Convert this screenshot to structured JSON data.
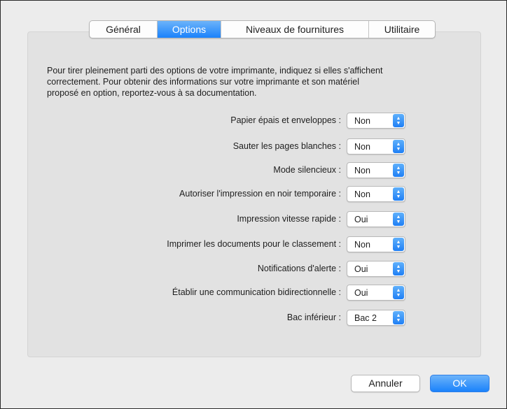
{
  "tabs": [
    {
      "label": "Général"
    },
    {
      "label": "Options"
    },
    {
      "label": "Niveaux de fournitures"
    },
    {
      "label": "Utilitaire"
    }
  ],
  "active_tab": "Options",
  "intro": {
    "line1": "Pour tirer pleinement parti des options de votre imprimante, indiquez si elles s'affichent",
    "line2": "correctement. Pour obtenir des informations sur votre imprimante et son matériel",
    "line3": "proposé en option, reportez-vous à sa documentation."
  },
  "options": [
    {
      "label": "Papier épais et enveloppes :",
      "value": "Non"
    },
    {
      "label": "Sauter les pages blanches :",
      "value": "Non"
    },
    {
      "label": "Mode silencieux :",
      "value": "Non"
    },
    {
      "label": "Autoriser l'impression en noir temporaire :",
      "value": "Non"
    },
    {
      "label": "Impression vitesse rapide :",
      "value": "Oui"
    },
    {
      "label": "Imprimer les documents pour le classement :",
      "value": "Non"
    },
    {
      "label": "Notifications d'alerte :",
      "value": "Oui"
    },
    {
      "label": "Établir une communication bidirectionnelle :",
      "value": "Oui"
    },
    {
      "label": "Bac inférieur :",
      "value": "Bac 2"
    }
  ],
  "buttons": {
    "cancel": "Annuler",
    "ok": "OK"
  },
  "colors": {
    "accent": "#1a82fb",
    "panel": "#e2e2e2",
    "window": "#ececec"
  },
  "icons": {
    "popup_arrows": "up-down-chevron-icon"
  }
}
